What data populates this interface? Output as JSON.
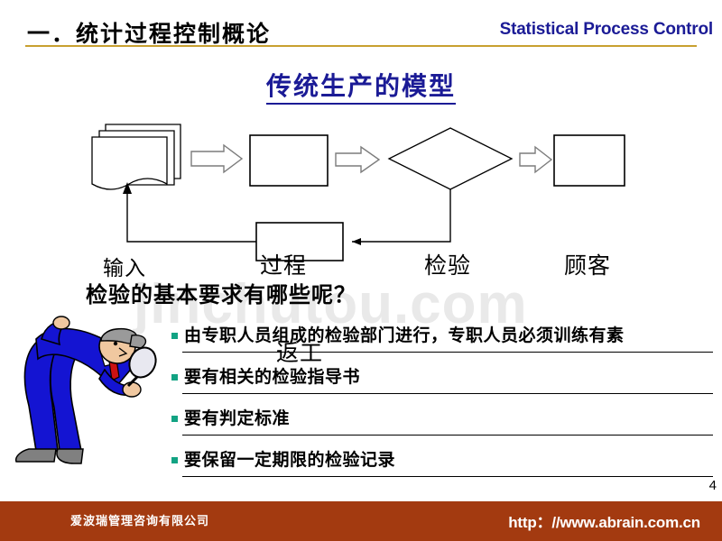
{
  "header": {
    "title_cn": "一．统计过程控制概论",
    "title_en": "Statistical Process Control",
    "rule_color": "#c8a030"
  },
  "slide": {
    "subtitle": "传统生产的模型",
    "subtitle_color": "#1b1b96",
    "page_number": "4"
  },
  "watermark": {
    "text": "jinchutou.com",
    "color": "#e9e9e9"
  },
  "flowchart": {
    "nodes": [
      {
        "id": "input",
        "label": "输入",
        "shape": "stacked-document"
      },
      {
        "id": "process",
        "label": "过程",
        "shape": "rectangle"
      },
      {
        "id": "inspect",
        "label": "检验",
        "shape": "diamond"
      },
      {
        "id": "customer",
        "label": "顾客",
        "shape": "rectangle"
      },
      {
        "id": "rework",
        "label": "返工",
        "shape": "rectangle"
      }
    ],
    "connectors": [
      {
        "from": "input",
        "to": "process",
        "style": "block-arrow"
      },
      {
        "from": "process",
        "to": "inspect",
        "style": "block-arrow"
      },
      {
        "from": "inspect",
        "to": "customer",
        "style": "block-arrow"
      },
      {
        "from": "inspect",
        "to": "rework",
        "style": "line-arrow"
      },
      {
        "from": "rework",
        "to": "input",
        "style": "line-arrow"
      }
    ]
  },
  "question": {
    "text": "检验的基本要求有哪些呢？"
  },
  "clipart": {
    "name": "inspector-with-magnifier",
    "suit_color": "#1414d2",
    "shoe_color": "#808080",
    "tie_color": "#cc1111"
  },
  "bullets": {
    "marker_color": "#12a383",
    "items": [
      {
        "text": "由专职人员组成的检验部门进行，专职人员必须训练有素"
      },
      {
        "text": "要有相关的检验指导书"
      },
      {
        "text": "要有判定标准"
      },
      {
        "text": "要保留一定期限的检验记录"
      }
    ]
  },
  "footer": {
    "company": "爱波瑞管理咨询有限公司",
    "url": "http：//www.abrain.com.cn",
    "background": "#a33a10"
  }
}
